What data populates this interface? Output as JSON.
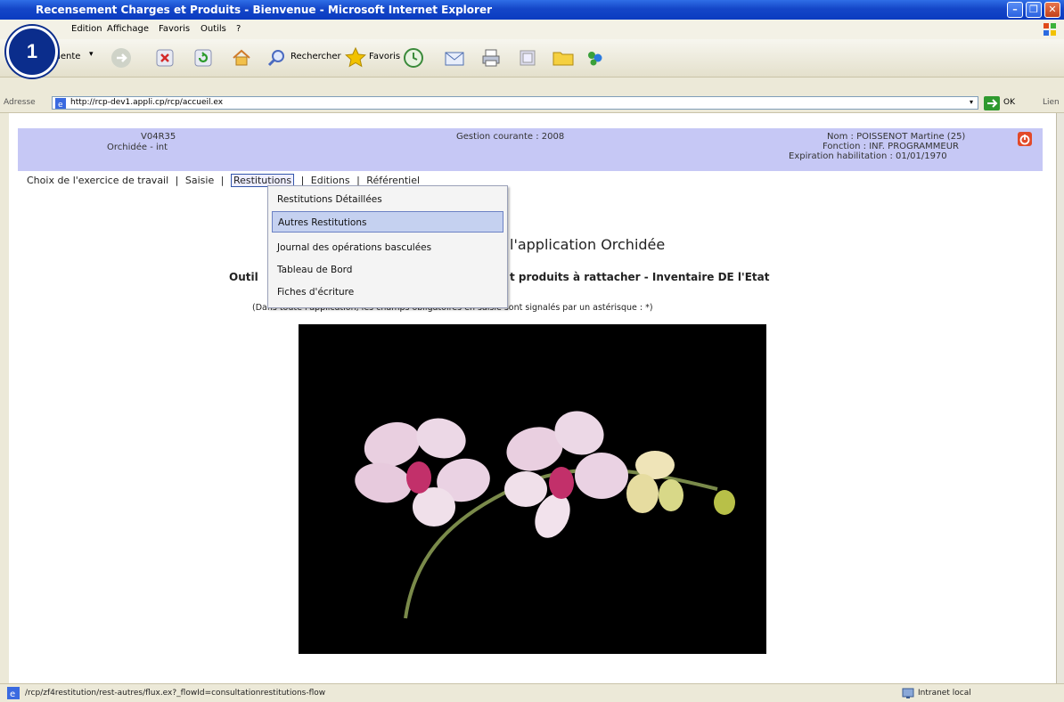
{
  "window": {
    "title": "Recensement Charges et Produits - Bienvenue - Microsoft Internet Explorer"
  },
  "step_badge": "1",
  "menubar": [
    "Edition",
    "Affichage",
    "Favoris",
    "Outils",
    "?"
  ],
  "toolbar": {
    "back_label": "Précédente",
    "search_label": "Rechercher",
    "favorites_label": "Favoris"
  },
  "address": {
    "label": "Adresse",
    "url": "http://rcp-dev1.appli.cp/rcp/accueil.ex",
    "go_label": "OK",
    "links_label": "Lien"
  },
  "header": {
    "version": "V04R35",
    "environment": "Orchidée - int",
    "gestion": "Gestion courante : 2008",
    "user_name": "Nom : POISSENOT Martine (25)",
    "user_function": "Fonction : INF. PROGRAMMEUR",
    "expiration": "Expiration habilitation : 01/01/1970"
  },
  "nav": {
    "items": [
      "Choix de l'exercice de travail",
      "Saisie",
      "Restitutions",
      "Editions",
      "Référentiel"
    ],
    "separator": "|"
  },
  "dropdown": {
    "items": [
      "Restitutions Détaillées",
      "Autres Restitutions",
      "Journal des opérations basculées",
      "Tableau de Bord",
      "Fiches d'écriture"
    ],
    "selected_index": 1
  },
  "page": {
    "welcome": "l'application Orchidée",
    "outil_left": "Outil",
    "outil_right": "t produits à rattacher - Inventaire DE l'Etat",
    "note": "(Dans toute l'application, les champs obligatoires en saisie sont signalés par un astérisque : *)"
  },
  "status": {
    "url": "/rcp/zf4restitution/rest-autres/flux.ex?_flowId=consultationrestitutions-flow",
    "zone": "Intranet local"
  },
  "colors": {
    "header_bg": "#c6c8f5",
    "titlebar": "#1446c8",
    "selected_item": "#c5d1f0"
  }
}
